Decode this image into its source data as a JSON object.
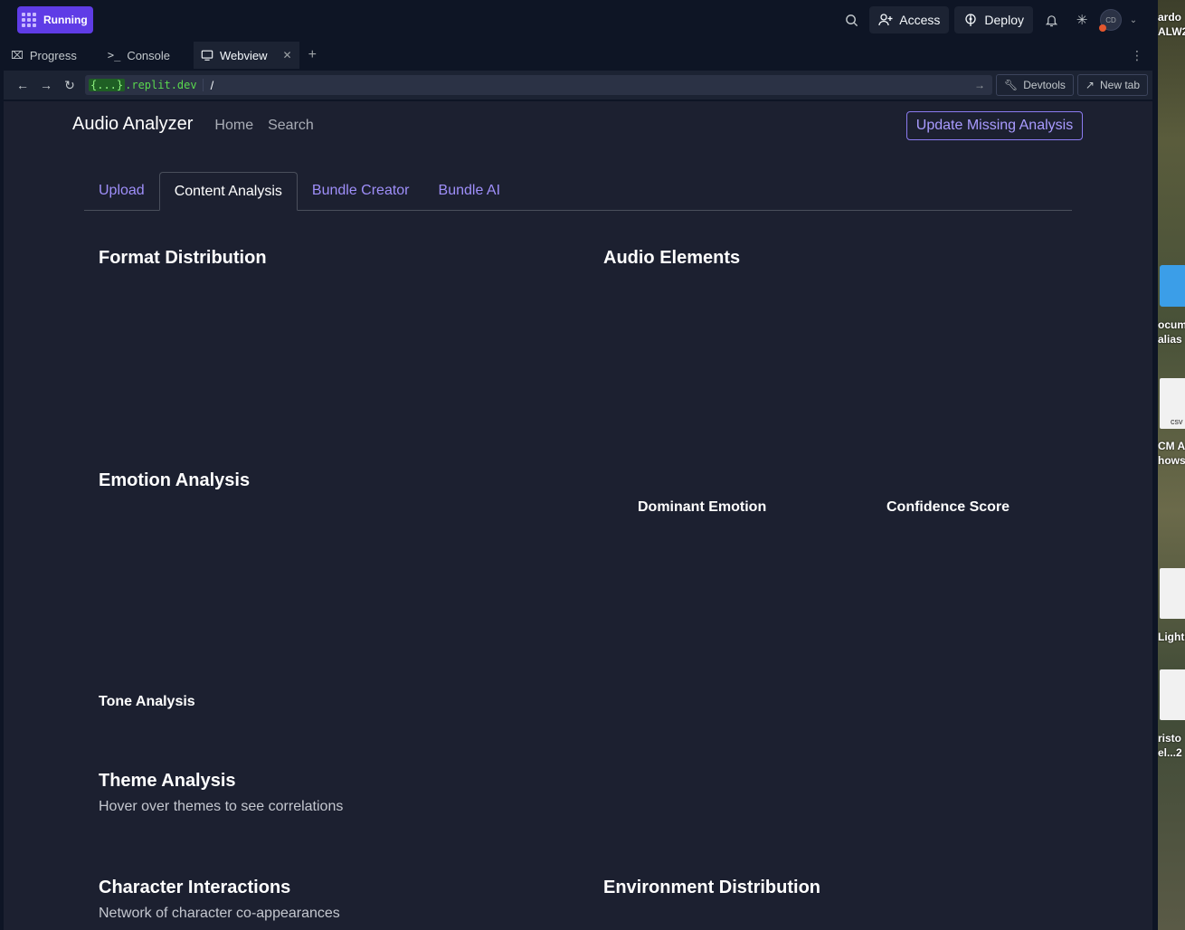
{
  "topbar": {
    "run_status": "Running",
    "access_label": "Access",
    "deploy_label": "Deploy",
    "avatar_initials": "CD"
  },
  "panel_tabs": [
    {
      "label": "Progress"
    },
    {
      "label": "Console"
    },
    {
      "label": "Webview"
    }
  ],
  "urlbar": {
    "host_prefix": "{...}",
    "host_suffix": ".replit.dev",
    "path": "/",
    "devtools_label": "Devtools",
    "newtab_label": "New tab"
  },
  "app": {
    "brand": "Audio Analyzer",
    "nav": [
      "Home",
      "Search"
    ],
    "update_button": "Update Missing Analysis",
    "tabs": [
      "Upload",
      "Content Analysis",
      "Bundle Creator",
      "Bundle AI"
    ],
    "active_tab": "Content Analysis",
    "sections": {
      "format_distribution": "Format Distribution",
      "audio_elements": "Audio Elements",
      "emotion_analysis": "Emotion Analysis",
      "dominant_emotion": "Dominant Emotion",
      "confidence_score": "Confidence Score",
      "tone_analysis": "Tone Analysis",
      "theme_analysis": "Theme Analysis",
      "theme_sub": "Hover over themes to see correlations",
      "character_interactions": "Character Interactions",
      "character_sub": "Network of character co-appearances",
      "environment_distribution": "Environment Distribution"
    }
  },
  "desktop_labels": [
    "ardo",
    "ALW2",
    "ocum",
    "alias",
    "csv",
    "CM Au",
    "hows.",
    "Lighti",
    "risto",
    "el...2"
  ],
  "colors": {
    "accent": "#5f3ce6",
    "link": "#9f8ffa",
    "webview_bg": "#1c2030",
    "chrome_bg": "#0e1525"
  }
}
